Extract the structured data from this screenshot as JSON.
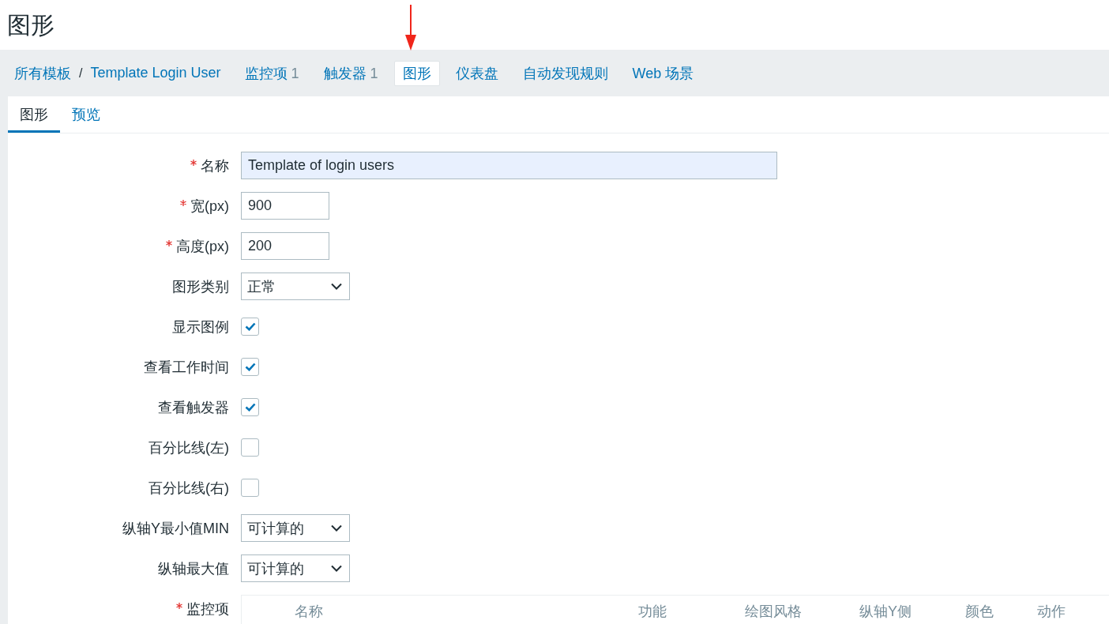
{
  "page_title": "图形",
  "breadcrumbs": [
    {
      "label": "所有模板"
    },
    {
      "label": "Template Login User"
    }
  ],
  "breadcrumb_separator": "/",
  "nav_tabs": [
    {
      "label": "监控项",
      "count": "1",
      "selected": false
    },
    {
      "label": "触发器",
      "count": "1",
      "selected": false
    },
    {
      "label": "图形",
      "selected": true
    },
    {
      "label": "仪表盘",
      "selected": false
    },
    {
      "label": "自动发现规则",
      "selected": false
    },
    {
      "label": "Web 场景",
      "selected": false
    }
  ],
  "subtabs": [
    {
      "label": "图形",
      "selected": true
    },
    {
      "label": "预览",
      "selected": false
    }
  ],
  "form": {
    "rows": [
      {
        "kind": "text",
        "label": "名称",
        "required": true,
        "value": "Template of login users",
        "autofilled": true
      },
      {
        "kind": "number",
        "label": "宽(px)",
        "required": true,
        "value": "900"
      },
      {
        "kind": "number",
        "label": "高度(px)",
        "required": true,
        "value": "200"
      },
      {
        "kind": "select",
        "label": "图形类别",
        "required": false,
        "value": "正常"
      },
      {
        "kind": "checkbox",
        "label": "显示图例",
        "required": false,
        "checked": true
      },
      {
        "kind": "checkbox",
        "label": "查看工作时间",
        "required": false,
        "checked": true
      },
      {
        "kind": "checkbox",
        "label": "查看触发器",
        "required": false,
        "checked": true
      },
      {
        "kind": "checkbox",
        "label": "百分比线(左)",
        "required": false,
        "checked": false
      },
      {
        "kind": "checkbox",
        "label": "百分比线(右)",
        "required": false,
        "checked": false
      },
      {
        "kind": "select",
        "label": "纵轴Y最小值MIN",
        "required": false,
        "value": "可计算的"
      },
      {
        "kind": "select",
        "label": "纵轴最大值",
        "required": false,
        "value": "可计算的"
      },
      {
        "kind": "items_table",
        "label": "监控项",
        "required": true,
        "columns": [
          "名称",
          "功能",
          "绘图风格",
          "纵轴Y侧",
          "颜色",
          "动作"
        ]
      }
    ]
  }
}
